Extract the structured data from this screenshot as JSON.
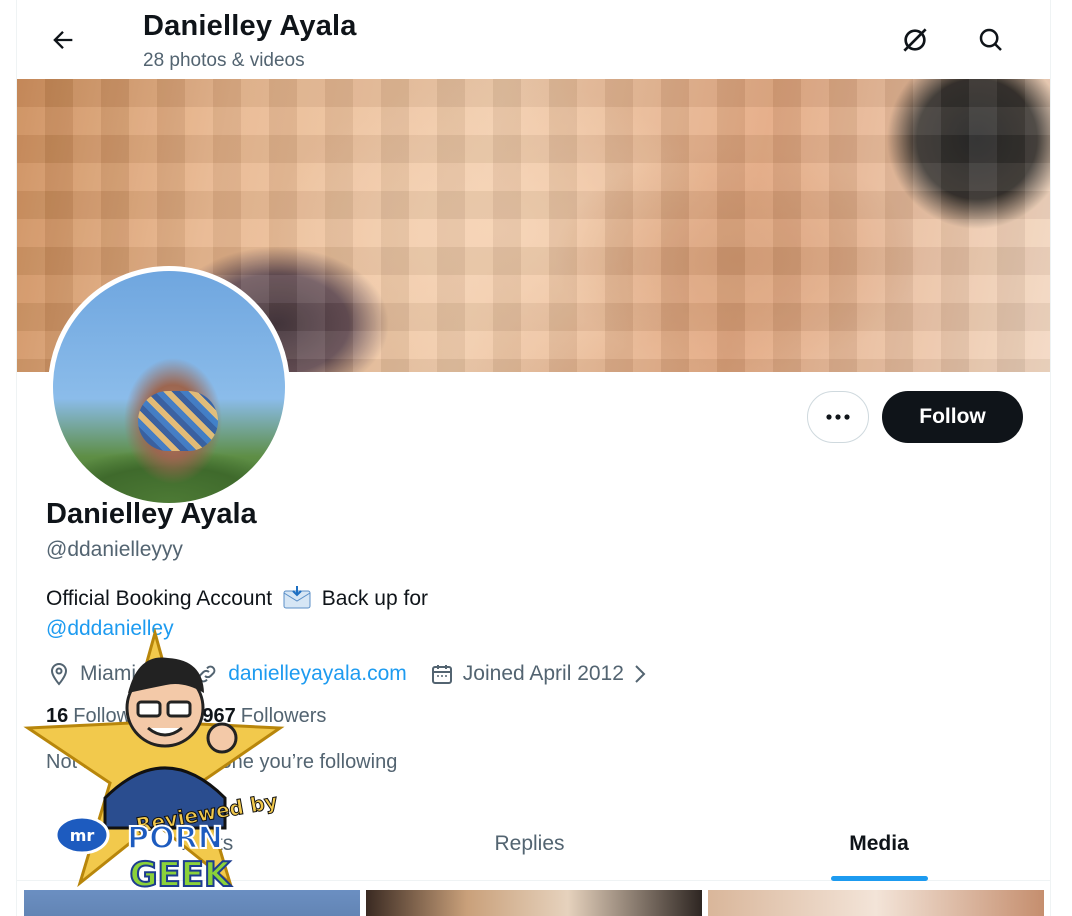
{
  "header": {
    "title": "Danielley Ayala",
    "subtitle": "28 photos & videos",
    "icons": [
      "back-arrow-icon",
      "grok-icon",
      "search-icon"
    ]
  },
  "profile": {
    "name": "Danielley Ayala",
    "handle": "@ddanielleyyy",
    "bio_text": "Official Booking Account",
    "bio_text_2": "Back up for",
    "bio_mention": "@dddanielley",
    "location": "Miami, FL",
    "website": "danielleyayala.com",
    "joined": "Joined April 2012",
    "following_count": "16",
    "following_label": "Following",
    "followers_count": "4,967",
    "followers_label": "Followers",
    "followed_by": "Not followed by anyone you’re following"
  },
  "actions": {
    "more_icon": "more-horizontal-icon",
    "follow_label": "Follow"
  },
  "tabs": [
    {
      "label": "Posts"
    },
    {
      "label": "Replies"
    },
    {
      "label": "Media",
      "active": true
    }
  ],
  "badge": {
    "text_1": "Reviewed by",
    "text_2": "mr",
    "text_3": "PORN",
    "text_4": "GEEK"
  },
  "colors": {
    "accent": "#1d9bf0",
    "text_primary": "#0f1419",
    "text_secondary": "#536471",
    "follow_bg": "#0f1419"
  }
}
